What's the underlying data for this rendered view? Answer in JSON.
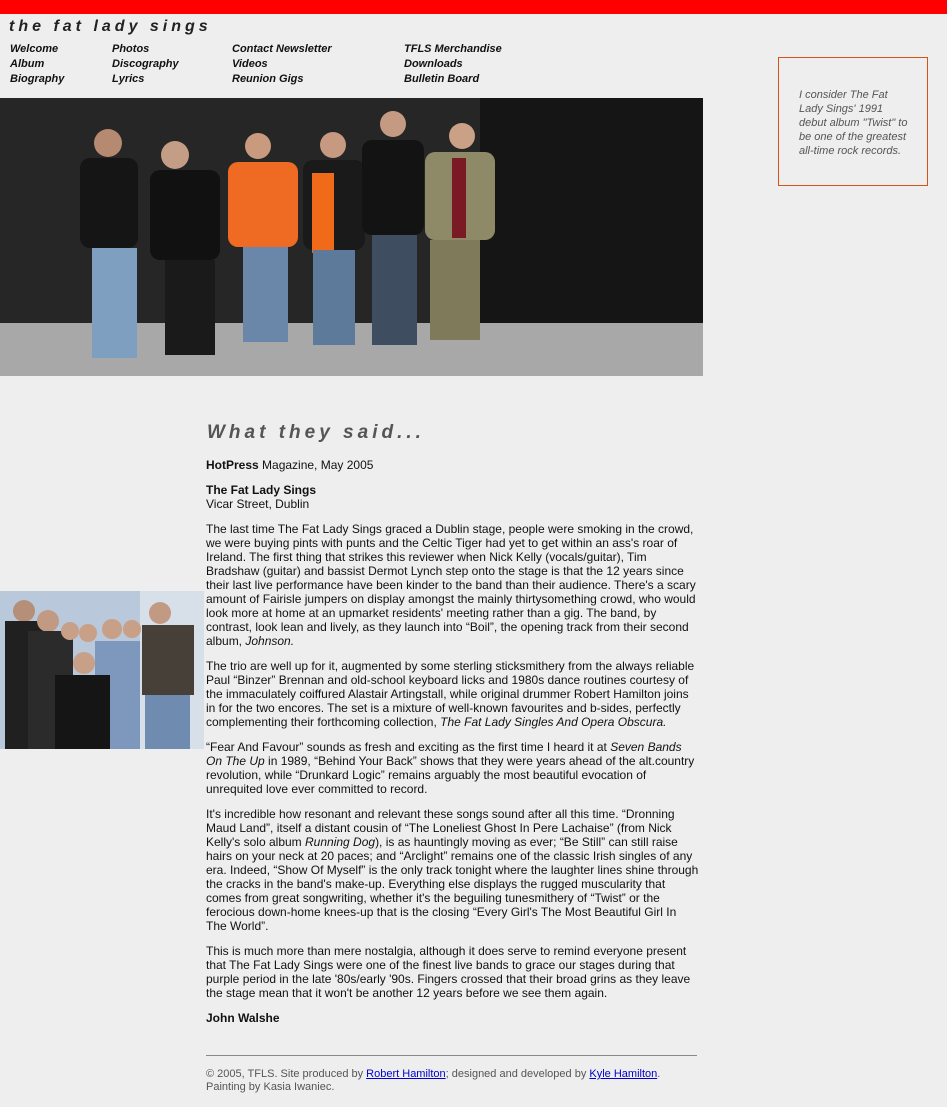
{
  "site": {
    "title": "the fat lady sings"
  },
  "nav": {
    "col1": [
      "Welcome",
      "Album",
      "Biography"
    ],
    "col2": [
      "Photos",
      "Discography",
      "Lyrics"
    ],
    "col3": [
      "Contact Newsletter",
      "Videos",
      "Reunion Gigs"
    ],
    "col4": [
      "TFLS Merchandise",
      "Downloads",
      "Bulletin Board"
    ]
  },
  "quote": "I consider The Fat Lady Sings' 1991 debut album \"Twist\" to be one of the greatest all-time rock records.",
  "heading": "What they said...",
  "article": {
    "source_bold": "HotPress",
    "source_rest": " Magazine, May 2005",
    "event_title": "The Fat Lady Sings",
    "venue": "Vicar Street, Dublin",
    "p1": "The last time The Fat Lady Sings graced a Dublin stage, people were smoking in the crowd, we were buying pints with punts and the Celtic Tiger had yet to get within an ass's roar of Ireland.  The first thing that strikes this reviewer when Nick Kelly (vocals/guitar), Tim Bradshaw (guitar) and bassist Dermot Lynch step onto the stage is that the 12 years since their last live performance have been kinder to the band than their audience.  There's a scary amount of Fairisle jumpers on display amongst the mainly thirtysomething crowd, who would look more at home at an upmarket residents' meeting rather than a gig.  The band, by contrast, look lean and lively, as they launch into “Boil”, the opening track from their second album, ",
    "p1_italic": "Johnson.",
    "p2": "The trio are well up for it, augmented by some sterling sticksmithery from the always reliable Paul “Binzer” Brennan and old-school keyboard licks and 1980s dance routines courtesy of the immaculately coiffured Alastair Artingstall, while original drummer Robert Hamilton joins in for the two encores.  The set is a mixture of well-known favourites and b-sides, perfectly complementing their forthcoming collection, ",
    "p2_italic": "The Fat Lady Singles And Opera Obscura.",
    "p3_a": "“Fear And Favour” sounds as fresh and exciting as the first time I heard it at ",
    "p3_italic": "Seven Bands On The Up",
    "p3_b": " in 1989, “Behind Your Back” shows that they were years ahead of the alt.country revolution, while “Drunkard Logic” remains arguably the most beautiful evocation of unrequited love ever committed to record.",
    "p4_a": "It's incredible how resonant and relevant these songs sound after all this time.  “Dronning Maud Land”, itself a distant cousin of “The Loneliest Ghost In Pere Lachaise” (from Nick Kelly's solo album ",
    "p4_italic": "Running Dog",
    "p4_b": "), is as hauntingly moving as ever; “Be Still” can still raise hairs on your neck at 20 paces; and “Arclight” remains one of the classic Irish singles of any era.  Indeed, “Show Of Myself” is the only track tonight where the laughter lines shine through the cracks in the band's make-up.  Everything else displays the rugged muscularity that comes from great songwriting, whether it's the beguiling tunesmithery of “Twist” or the ferocious down-home knees-up that is the closing “Every Girl's The Most Beautiful Girl In The World”.",
    "p5": "This is much more than mere nostalgia, although it does serve to remind everyone present that The Fat Lady Sings were one of the finest live bands to grace our stages during that purple period in the late '80s/early '90s.  Fingers crossed that their broad grins as they leave the stage mean that it won't be another 12 years before we see them again.",
    "author": "John Walshe"
  },
  "footer": {
    "pre": "© 2005, TFLS. Site produced by ",
    "link1": "Robert Hamilton",
    "mid": "; designed and developed by ",
    "link2": "Kyle Hamilton",
    "post": ".",
    "line2": "Painting by Kasia Iwaniec."
  },
  "colors": {
    "topbar": "#ff0000",
    "quote_border": "#d5521b",
    "link": "#0000cc"
  }
}
